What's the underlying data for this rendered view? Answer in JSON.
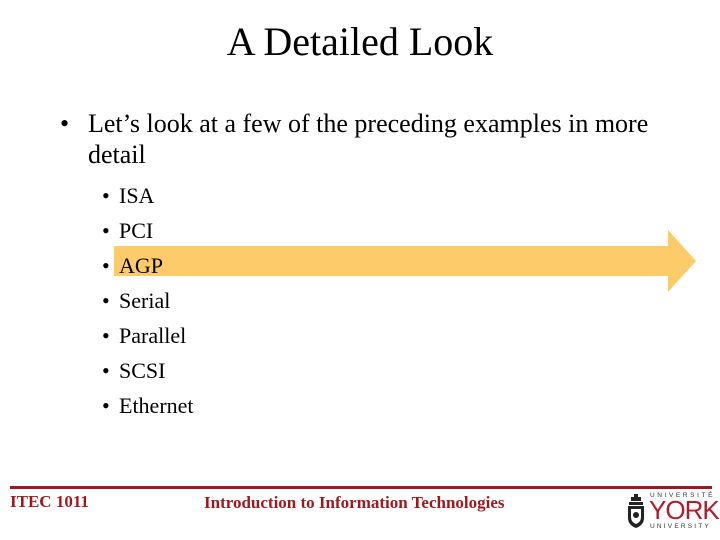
{
  "slide": {
    "title": "A Detailed Look",
    "main_bullet": {
      "marker": "•",
      "text": "Let’s look at a few of the preceding examples in more detail"
    },
    "sub_bullets": [
      {
        "marker": "•",
        "label": "ISA"
      },
      {
        "marker": "•",
        "label": "PCI"
      },
      {
        "marker": "•",
        "label": "AGP"
      },
      {
        "marker": "•",
        "label": "Serial"
      },
      {
        "marker": "•",
        "label": "Parallel"
      },
      {
        "marker": "•",
        "label": "SCSI"
      },
      {
        "marker": "•",
        "label": "Ethernet"
      }
    ],
    "highlighted_item": "AGP",
    "highlight_color": "#FDCB6A"
  },
  "footer": {
    "course_code": "ITEC 1011",
    "course_title": "Introduction to Information Technologies",
    "accent_color": "#9C1A1F",
    "logo": {
      "top_text": "UNIVERSITÉ",
      "main_text": "YORK",
      "bottom_text": "UNIVERSITY"
    }
  }
}
